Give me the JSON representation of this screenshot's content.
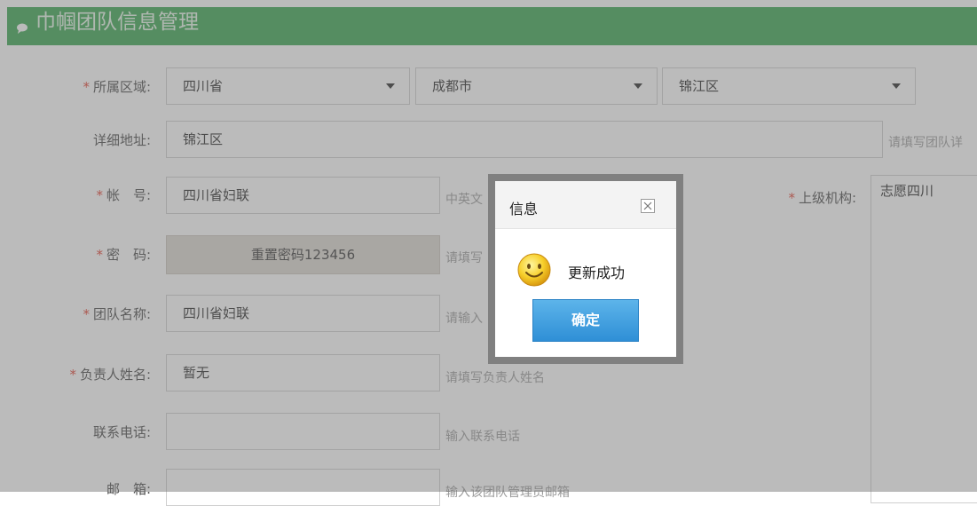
{
  "header": {
    "title": "巾帼团队信息管理"
  },
  "form": {
    "region": {
      "label": "所属区域:",
      "province": "四川省",
      "city": "成都市",
      "district": "锦江区"
    },
    "address": {
      "label": "详细地址:",
      "value": "锦江区",
      "hint": "请填写团队详"
    },
    "account": {
      "label": "帐　号:",
      "value": "四川省妇联",
      "hint": "中英文"
    },
    "password": {
      "label": "密　码:",
      "button": "重置密码123456",
      "hint": "请填写"
    },
    "team_name": {
      "label": "团队名称:",
      "value": "四川省妇联",
      "hint": "请输入"
    },
    "leader": {
      "label": "负责人姓名:",
      "value": "暂无",
      "hint": "请填写负责人姓名"
    },
    "phone": {
      "label": "联系电话:",
      "value": "",
      "hint": "输入联系电话"
    },
    "email": {
      "label": "邮　箱:",
      "value": "",
      "hint": "输入该团队管理员邮箱"
    },
    "parent_org": {
      "label": "上级机构:",
      "value": "志愿四川"
    },
    "required_mark": "*"
  },
  "dialog": {
    "title": "信息",
    "message": "更新成功",
    "ok_label": "确定"
  },
  "colors": {
    "header_green": "#32a34a",
    "required_red": "#e03a2a",
    "ok_blue": "#2f8fd6"
  },
  "icons": {
    "header": "chat-bubble-icon",
    "close": "close-icon",
    "smile": "smiley-icon",
    "dropdown": "chevron-down-icon"
  }
}
